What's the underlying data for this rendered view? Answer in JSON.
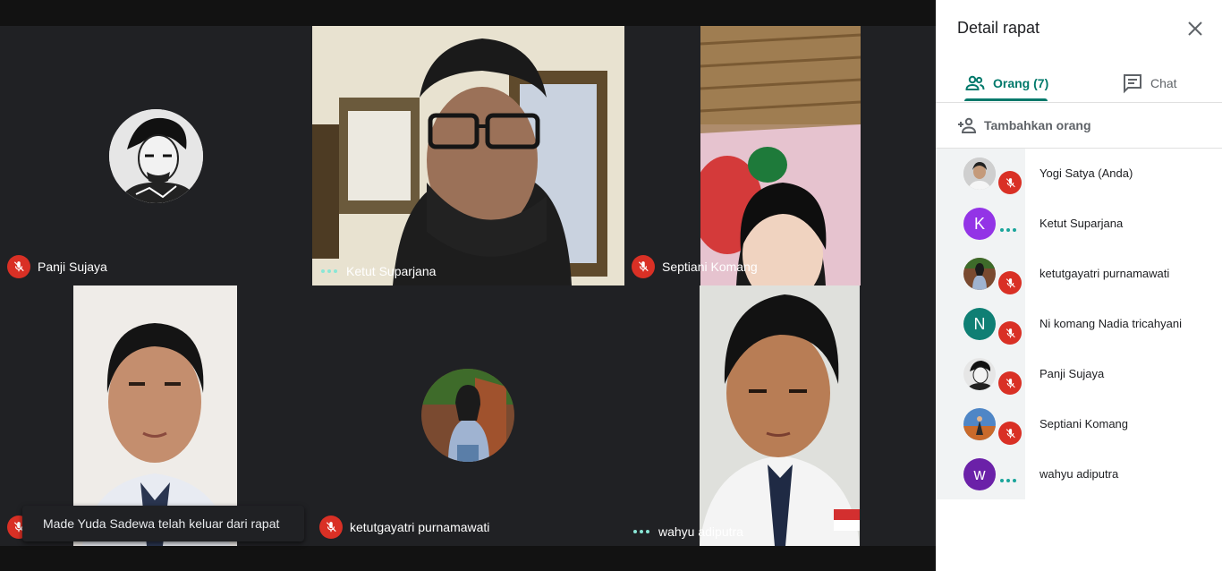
{
  "tiles": [
    {
      "name": "Panji Sujaya",
      "muted": true
    },
    {
      "name": "Ketut Suparjana",
      "muted": false
    },
    {
      "name": "Septiani Komang",
      "muted": true
    },
    {
      "name": "ketutgayatri purnamawati",
      "muted": true
    },
    {
      "name": "wahyu adiputra",
      "muted": false
    }
  ],
  "toast": "Made Yuda Sadewa telah keluar dari rapat",
  "panel": {
    "title": "Detail rapat",
    "tab_people": "Orang (7)",
    "tab_chat": "Chat",
    "add_people": "Tambahkan orang",
    "people": [
      {
        "name": "Yogi Satya (Anda)",
        "muted": true
      },
      {
        "name": "Ketut Suparjana",
        "muted": false,
        "initial": "K",
        "color": "#9334e6"
      },
      {
        "name": "ketutgayatri purnamawati",
        "muted": true
      },
      {
        "name": "Ni komang Nadia tricahyani",
        "muted": true,
        "initial": "N",
        "color": "#0f7f74"
      },
      {
        "name": "Panji Sujaya",
        "muted": true
      },
      {
        "name": "Septiani Komang",
        "muted": true
      },
      {
        "name": "wahyu adiputra",
        "muted": false,
        "initial": "w",
        "color": "#6b21a8"
      }
    ]
  },
  "colors": {
    "accent": "#00796b",
    "mic_off": "#d93025",
    "speaking_dots": "#8ae6d6"
  }
}
